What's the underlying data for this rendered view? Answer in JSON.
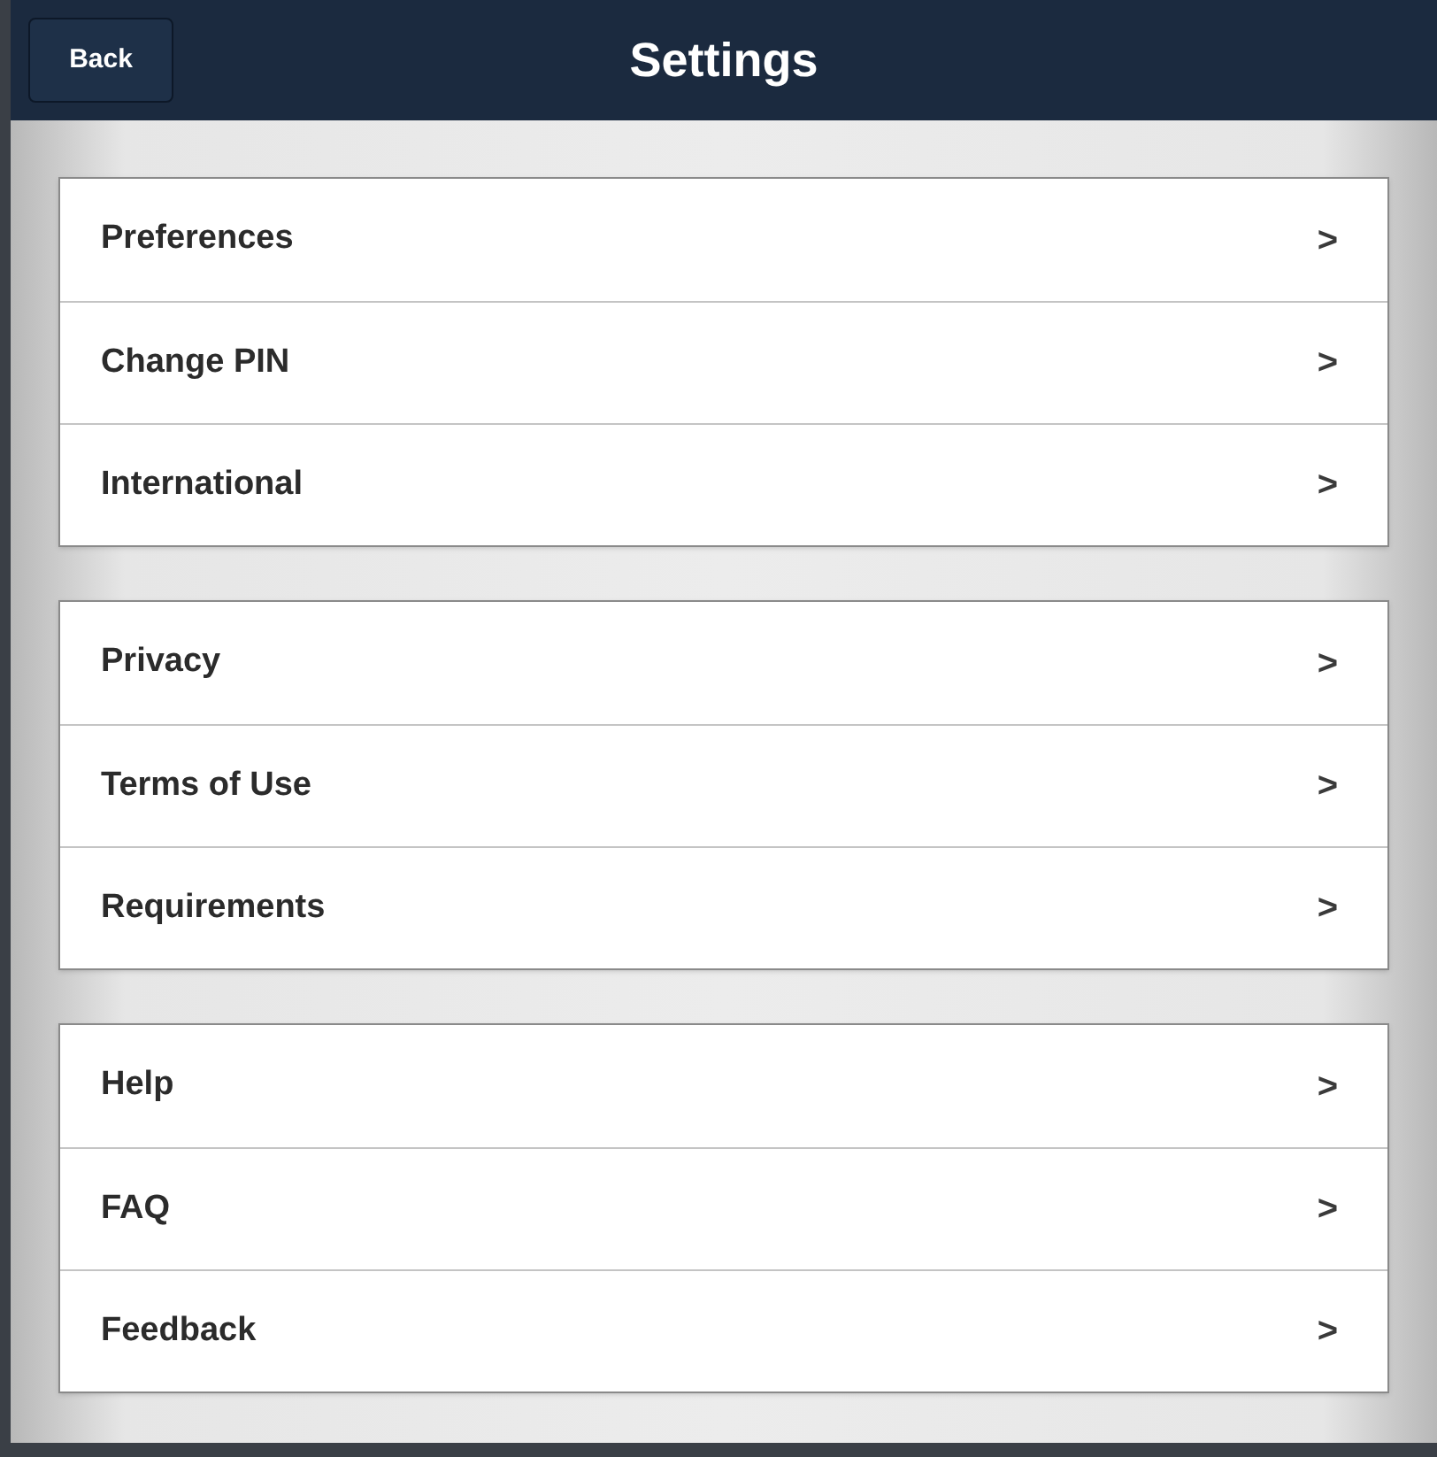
{
  "header": {
    "back_button": "Back",
    "title": "Settings"
  },
  "groups": [
    {
      "items": [
        {
          "label": "Preferences",
          "chevron": ">"
        },
        {
          "label": "Change PIN",
          "chevron": ">"
        },
        {
          "label": "International",
          "chevron": ">"
        }
      ]
    },
    {
      "items": [
        {
          "label": "Privacy",
          "chevron": ">"
        },
        {
          "label": "Terms of Use",
          "chevron": ">"
        },
        {
          "label": "Requirements",
          "chevron": ">"
        }
      ]
    },
    {
      "items": [
        {
          "label": "Help",
          "chevron": ">"
        },
        {
          "label": "FAQ",
          "chevron": ">"
        },
        {
          "label": "Feedback",
          "chevron": ">"
        }
      ]
    }
  ]
}
